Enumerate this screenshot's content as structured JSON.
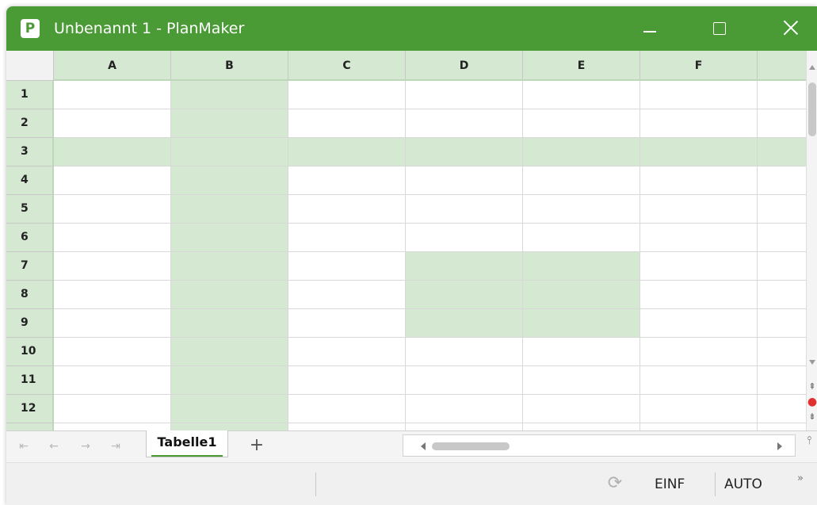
{
  "window": {
    "app_icon_letter": "P",
    "title": "Unbenannt 1 - PlanMaker",
    "accent": "#4a9a36",
    "selection_color": "#d4e8d2"
  },
  "grid": {
    "columns": [
      "A",
      "B",
      "C",
      "D",
      "E",
      "F"
    ],
    "rows": [
      "1",
      "2",
      "3",
      "4",
      "5",
      "6",
      "7",
      "8",
      "9",
      "10",
      "11",
      "12"
    ],
    "selected_column": "B",
    "selected_row": "3",
    "selected_range": "D7:E9"
  },
  "sheets": {
    "tabs": [
      "Tabelle1"
    ],
    "active": "Tabelle1",
    "add_icon": "plus-icon",
    "nav_icons": [
      "first-sheet-icon",
      "prev-sheet-icon",
      "next-sheet-icon",
      "last-sheet-icon"
    ]
  },
  "statusbar": {
    "sync_icon": "sync-icon",
    "insert_mode": "EINF",
    "calc_mode": "AUTO",
    "more_icon": "chevron-double-right-icon"
  }
}
